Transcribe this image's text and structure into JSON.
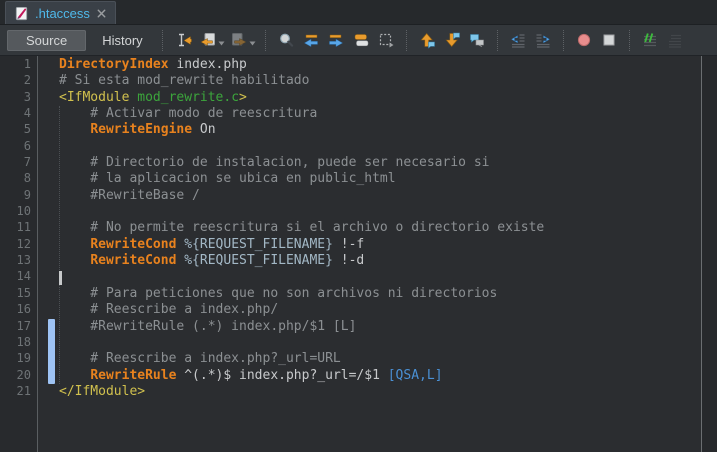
{
  "tabbar": {
    "tab": {
      "title": ".htaccess",
      "icon": "text-file-icon",
      "close_icon": "close-icon"
    }
  },
  "toolbar": {
    "source_label": "Source",
    "history_label": "History",
    "groups": [
      {
        "icons": [
          {
            "name": "jump-to-cursor-icon"
          },
          {
            "name": "previous-document-icon",
            "dropdown": true
          },
          {
            "name": "next-document-icon",
            "dropdown": true,
            "disabled": true
          }
        ]
      },
      {
        "icons": [
          {
            "name": "search-icon"
          },
          {
            "name": "find-previous-icon"
          },
          {
            "name": "find-next-icon"
          },
          {
            "name": "switch-windows-icon"
          },
          {
            "name": "block-selection-icon"
          }
        ]
      },
      {
        "icons": [
          {
            "name": "previous-use-icon"
          },
          {
            "name": "next-use-icon"
          },
          {
            "name": "code-comments-icon"
          }
        ]
      },
      {
        "icons": [
          {
            "name": "unindent-icon"
          },
          {
            "name": "indent-icon"
          }
        ]
      },
      {
        "icons": [
          {
            "name": "record-macro-icon"
          },
          {
            "name": "stop-macro-icon"
          }
        ]
      },
      {
        "icons": [
          {
            "name": "comment-icon"
          },
          {
            "name": "uncomment-icon",
            "disabled": true
          }
        ]
      }
    ]
  },
  "editor": {
    "cursor": {
      "line": 14,
      "column": 0
    },
    "modified_bar": {
      "from_line": 17,
      "to_line": 20
    },
    "indent_guide": {
      "from_line": 4,
      "to_line": 20
    },
    "lines": [
      {
        "num": 1,
        "tokens": [
          {
            "t": "DirectoryIndex",
            "c": "directive"
          },
          {
            "t": " index.php",
            "c": "plain"
          }
        ]
      },
      {
        "num": 2,
        "tokens": [
          {
            "t": "# Si esta mod_rewrite habilitado",
            "c": "comment"
          }
        ]
      },
      {
        "num": 3,
        "tokens": [
          {
            "t": "<IfModule ",
            "c": "tag"
          },
          {
            "t": "mod_rewrite.c",
            "c": "module"
          },
          {
            "t": ">",
            "c": "tag"
          }
        ]
      },
      {
        "num": 4,
        "tokens": [
          {
            "t": "    # Activar modo de reescritura",
            "c": "comment"
          }
        ]
      },
      {
        "num": 5,
        "tokens": [
          {
            "t": "    ",
            "c": "plain"
          },
          {
            "t": "RewriteEngine",
            "c": "directive"
          },
          {
            "t": " On",
            "c": "plain"
          }
        ]
      },
      {
        "num": 6,
        "tokens": []
      },
      {
        "num": 7,
        "tokens": [
          {
            "t": "    # Directorio de instalacion, puede ser necesario si",
            "c": "comment"
          }
        ]
      },
      {
        "num": 8,
        "tokens": [
          {
            "t": "    # la aplicacion se ubica en public_html",
            "c": "comment"
          }
        ]
      },
      {
        "num": 9,
        "tokens": [
          {
            "t": "    #RewriteBase /",
            "c": "comment"
          }
        ]
      },
      {
        "num": 10,
        "tokens": []
      },
      {
        "num": 11,
        "tokens": [
          {
            "t": "    # No permite reescritura si el archivo o directorio existe",
            "c": "comment"
          }
        ]
      },
      {
        "num": 12,
        "tokens": [
          {
            "t": "    ",
            "c": "plain"
          },
          {
            "t": "RewriteCond",
            "c": "directive"
          },
          {
            "t": " ",
            "c": "plain"
          },
          {
            "t": "%{REQUEST_FILENAME}",
            "c": "variable"
          },
          {
            "t": " !-f",
            "c": "plain"
          }
        ]
      },
      {
        "num": 13,
        "tokens": [
          {
            "t": "    ",
            "c": "plain"
          },
          {
            "t": "RewriteCond",
            "c": "directive"
          },
          {
            "t": " ",
            "c": "plain"
          },
          {
            "t": "%{REQUEST_FILENAME}",
            "c": "variable"
          },
          {
            "t": " !-d",
            "c": "plain"
          }
        ]
      },
      {
        "num": 14,
        "tokens": []
      },
      {
        "num": 15,
        "tokens": [
          {
            "t": "    # Para peticiones que no son archivos ni directorios",
            "c": "comment"
          }
        ]
      },
      {
        "num": 16,
        "tokens": [
          {
            "t": "    # Reescribe a index.php/",
            "c": "comment"
          }
        ]
      },
      {
        "num": 17,
        "tokens": [
          {
            "t": "    #RewriteRule (.*) index.php/$1 [L]",
            "c": "comment"
          }
        ]
      },
      {
        "num": 18,
        "tokens": []
      },
      {
        "num": 19,
        "tokens": [
          {
            "t": "    # Reescribe a index.php?_url=URL",
            "c": "comment"
          }
        ]
      },
      {
        "num": 20,
        "tokens": [
          {
            "t": "    ",
            "c": "plain"
          },
          {
            "t": "RewriteRule",
            "c": "directive"
          },
          {
            "t": " ^(.*)$ index.php?_url=/$1 ",
            "c": "plain"
          },
          {
            "t": "[QSA,L]",
            "c": "flag"
          }
        ]
      },
      {
        "num": 21,
        "tokens": [
          {
            "t": "</IfModule>",
            "c": "tag"
          }
        ]
      }
    ]
  },
  "colors": {
    "directive": "#e8821e",
    "comment": "#8c9093",
    "tag": "#d1c14e",
    "module": "#3ca53c",
    "variable": "#a3b8c6",
    "plain": "#c8cacc",
    "flag": "#4a90d4",
    "tab_title": "#4fb8ea",
    "modified_bar": "#9ec3f4",
    "editor_bg": "#2b2d30",
    "gutter_bg": "#282a2d",
    "line_number": "#6e7376"
  }
}
